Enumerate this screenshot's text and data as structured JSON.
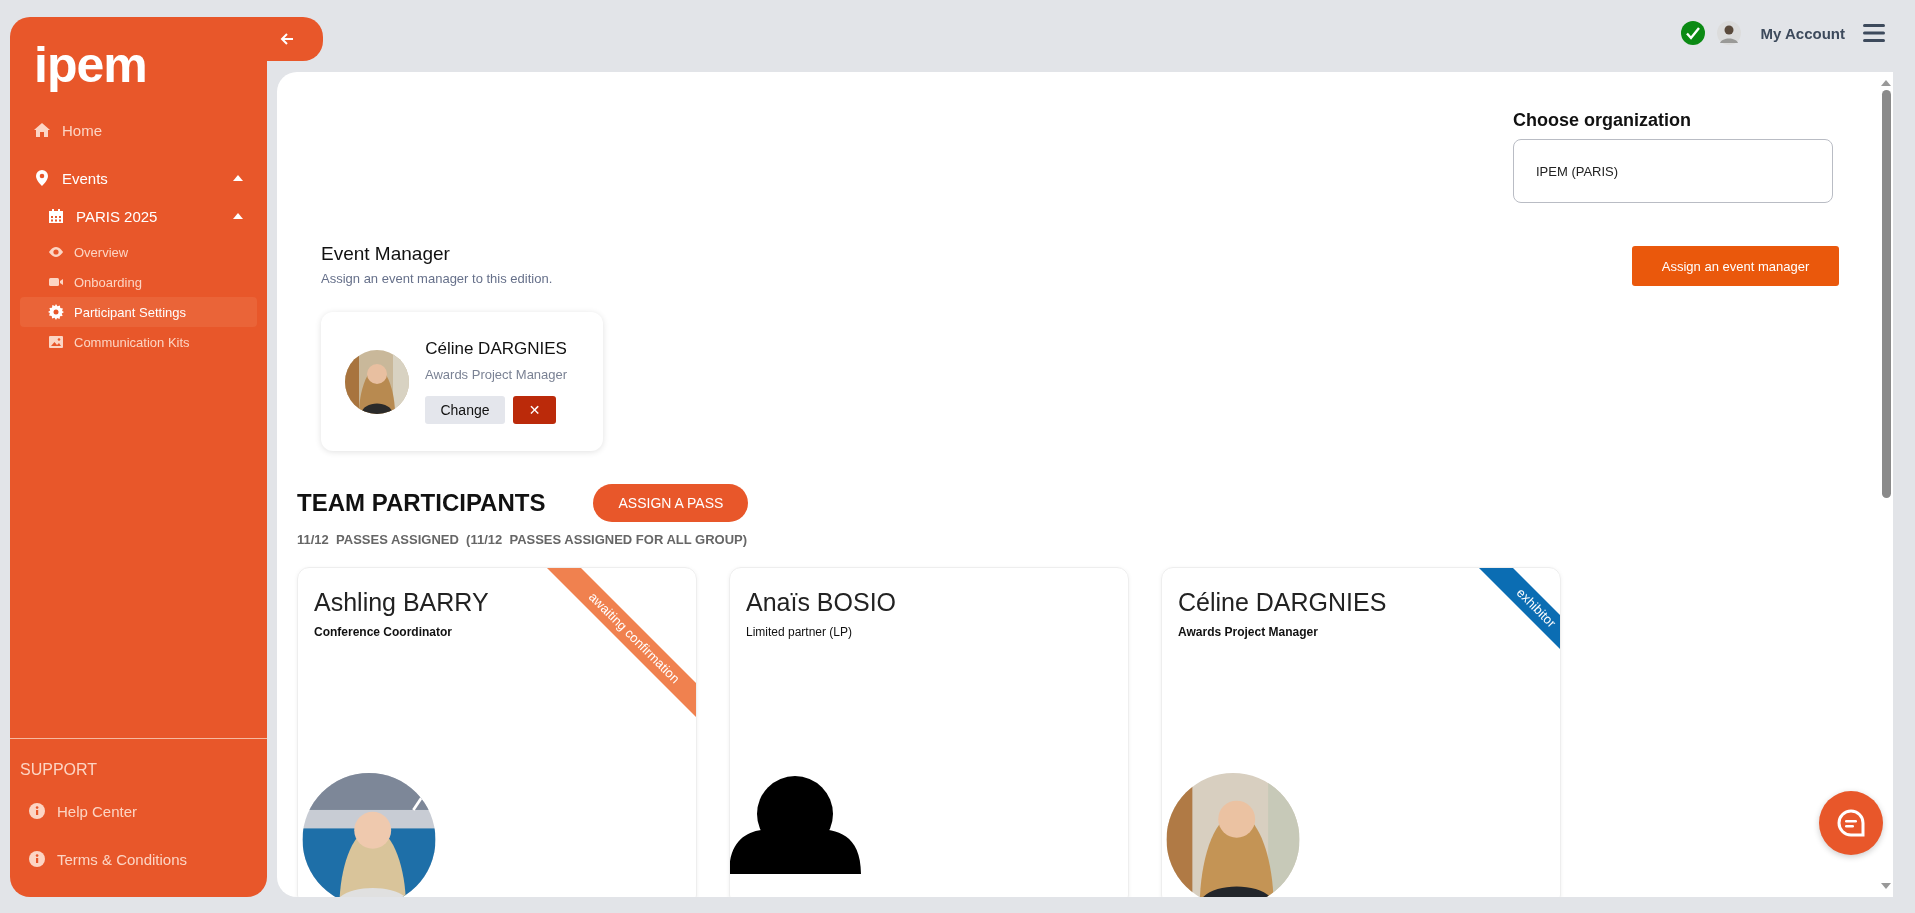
{
  "sidebar": {
    "logo": "ipem",
    "items": [
      {
        "label": "Home",
        "selected": false
      },
      {
        "label": "Events",
        "selected": false,
        "expanded": true,
        "children": [
          {
            "label": "PARIS 2025",
            "selected": false,
            "expanded": true,
            "children": [
              {
                "label": "Overview",
                "selected": false
              },
              {
                "label": "Onboarding",
                "selected": false
              },
              {
                "label": "Participant Settings",
                "selected": true
              },
              {
                "label": "Communication Kits",
                "selected": false
              }
            ]
          }
        ]
      }
    ],
    "support": {
      "title": "SUPPORT",
      "items": [
        {
          "label": "Help Center"
        },
        {
          "label": "Terms & Conditions"
        }
      ]
    }
  },
  "header": {
    "verified": true,
    "account_label": "My Account"
  },
  "organization": {
    "label": "Choose organization",
    "value": "IPEM (PARIS)"
  },
  "event_manager": {
    "title": "Event Manager",
    "subtitle": "Assign an event manager to this edition.",
    "assign_button": "Assign an event manager",
    "card": {
      "name": "Céline DARGNIES",
      "role": "Awards Project Manager",
      "change_button": "Change",
      "remove_button": "✕"
    }
  },
  "team": {
    "title": "TEAM PARTICIPANTS",
    "assign_button": "ASSIGN A PASS",
    "passes": "11/12  PASSES ASSIGNED  (11/12  PASSES ASSIGNED FOR ALL GROUP)",
    "participants": [
      {
        "name": "Ashling BARRY",
        "role": "Conference Coordinator",
        "role_bold": true,
        "photo": true,
        "ribbon": {
          "label": "awaiting confirmation",
          "color": "#f0814f"
        }
      },
      {
        "name": "Anaïs BOSIO",
        "role": "Limited partner (LP)",
        "role_bold": false,
        "photo": false
      },
      {
        "name": "Céline DARGNIES",
        "role": "Awards Project Manager",
        "role_bold": true,
        "photo": true,
        "ribbon": {
          "label": "exhibitor",
          "color": "#0b6db3"
        }
      }
    ]
  }
}
